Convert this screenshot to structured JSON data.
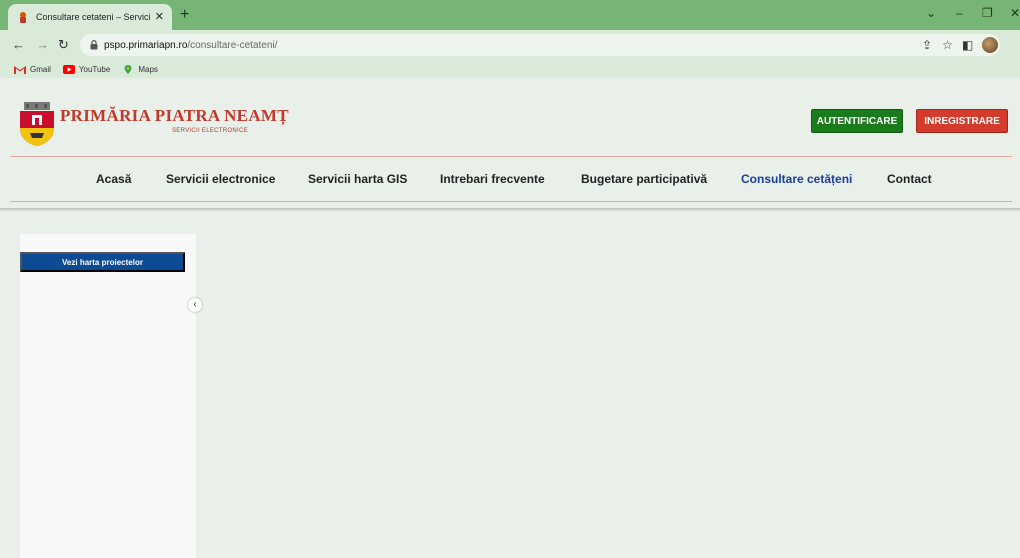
{
  "browser": {
    "tab_title": "Consultare cetateni – Servicii ele",
    "tab_close": "✕",
    "new_tab": "+",
    "url_host": "pspo.primariapn.ro",
    "url_path": "/consultare-cetateni/",
    "bookmarks": [
      {
        "label": "Gmail",
        "icon": "gmail-icon"
      },
      {
        "label": "YouTube",
        "icon": "youtube-icon"
      },
      {
        "label": "Maps",
        "icon": "maps-icon"
      }
    ]
  },
  "site": {
    "title": "PRIMĂRIA PIATRA NEAMȚ",
    "subtitle": "SERVICII ELECTRONICE",
    "login_label": "AUTENTIFICARE",
    "register_label": "INREGISTRARE",
    "nav": [
      {
        "label": "Acasă"
      },
      {
        "label": "Servicii electronice"
      },
      {
        "label": "Servicii harta GIS"
      },
      {
        "label": "Intrebari frecvente"
      },
      {
        "label": "Bugetare participativă"
      },
      {
        "label": "Consultare cetățeni",
        "active": true
      },
      {
        "label": "Contact"
      }
    ]
  },
  "content": {
    "map_button_label": "Vezi harta proiectelor",
    "collapse_glyph": "‹"
  },
  "colors": {
    "tabstrip": "#76b576",
    "login": "#1b7a1b",
    "register": "#d33b2c",
    "active_nav": "#1c3f9a",
    "map_button": "#0d4a94"
  }
}
